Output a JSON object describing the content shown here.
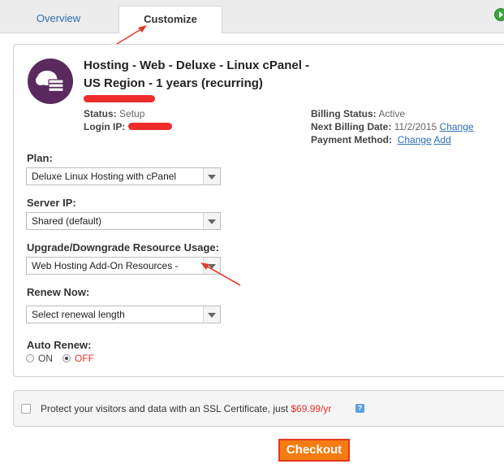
{
  "tabs": {
    "overview": "Overview",
    "customize": "Customize"
  },
  "product": {
    "title_line1": "Hosting - Web - Deluxe - Linux cPanel -",
    "title_line2": "US Region - 1 years (recurring)",
    "status_label": "Status:",
    "status_value": "Setup",
    "login_ip_label": "Login IP:",
    "billing_status_label": "Billing Status:",
    "billing_status_value": "Active",
    "next_billing_label": "Next Billing Date:",
    "next_billing_value": "11/2/2015",
    "change_link": "Change",
    "payment_method_label": "Payment Method:",
    "payment_change_link": "Change",
    "payment_add_link": "Add"
  },
  "form": {
    "plan_label": "Plan:",
    "plan_value": "Deluxe Linux Hosting with cPanel",
    "server_ip_label": "Server IP:",
    "server_ip_value": "Shared (default)",
    "upgrade_label": "Upgrade/Downgrade Resource Usage:",
    "upgrade_value": "Web Hosting Add-On Resources -",
    "renew_label": "Renew Now:",
    "renew_value": "Select renewal length",
    "auto_renew_label": "Auto Renew:",
    "on_label": "ON",
    "off_label": "OFF",
    "auto_renew_selected": "OFF"
  },
  "ssl": {
    "text": "Protect your visitors and data with an SSL Certificate, just",
    "price": "$69.99/yr",
    "help": "?"
  },
  "checkout_label": "Checkout",
  "colors": {
    "accent": "#f57c12",
    "link": "#2f6db5",
    "price": "#e2342a",
    "annotation": "#e23b2a"
  }
}
